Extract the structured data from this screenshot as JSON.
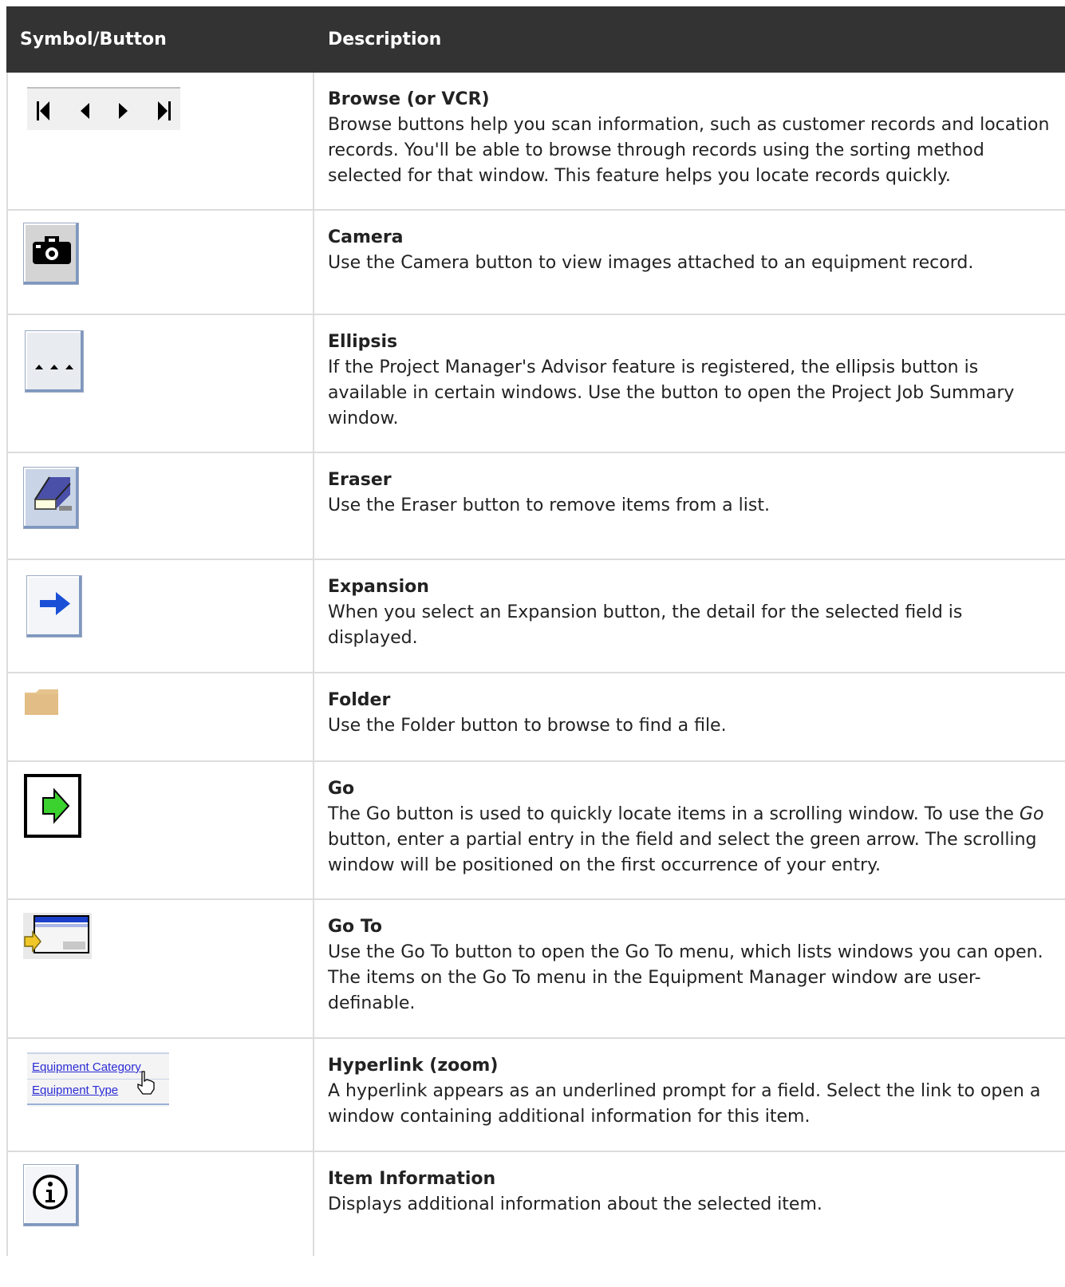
{
  "header": {
    "col1": "Symbol/Button",
    "col2": "Description"
  },
  "rows": [
    {
      "title": "Browse (or VCR)",
      "desc": "Browse buttons help you scan information, such as customer records and location records. You'll be able to browse through records using the sorting method selected for that window. This feature helps you locate records quickly.",
      "icon": "vcr-buttons-icon"
    },
    {
      "title": "Camera",
      "desc": "Use the Camera button to view images attached to an equipment record.",
      "icon": "camera-icon"
    },
    {
      "title": "Ellipsis",
      "desc": "If the Project Manager's Advisor feature is registered, the ellipsis button is available in certain windows. Use the button to open the Project Job Summary window.",
      "icon": "ellipsis-icon"
    },
    {
      "title": "Eraser",
      "desc": "Use the Eraser button to remove items from a list.",
      "icon": "eraser-icon"
    },
    {
      "title": "Expansion",
      "desc": "When you select an Expansion button, the detail for the selected field is displayed.",
      "icon": "expansion-arrow-icon"
    },
    {
      "title": "Folder",
      "desc": "Use the Folder button to browse to find a file.",
      "icon": "folder-icon"
    },
    {
      "title": "Go",
      "desc_before": "The Go button is used to quickly locate items in a scrolling window. To use the ",
      "desc_italic": "Go",
      "desc_after": " button, enter a partial entry in the field and select the green arrow. The scrolling window will be positioned on the first occurrence of your entry.",
      "icon": "go-arrow-icon"
    },
    {
      "title": "Go To",
      "desc": "Use the Go To button to open the Go To menu, which lists windows you can open. The items on the Go To menu in the Equipment Manager window are user-definable.",
      "icon": "go-to-icon"
    },
    {
      "title": "Hyperlink (zoom)",
      "desc": "A hyperlink appears as an underlined prompt for a field. Select the link to open a window containing additional information for this item.",
      "icon": "hyperlink-icon",
      "link1": "Equipment Category",
      "link2": "Equipment Type"
    },
    {
      "title": "Item Information",
      "desc": "Displays additional information about the selected item.",
      "icon": "info-icon"
    }
  ]
}
